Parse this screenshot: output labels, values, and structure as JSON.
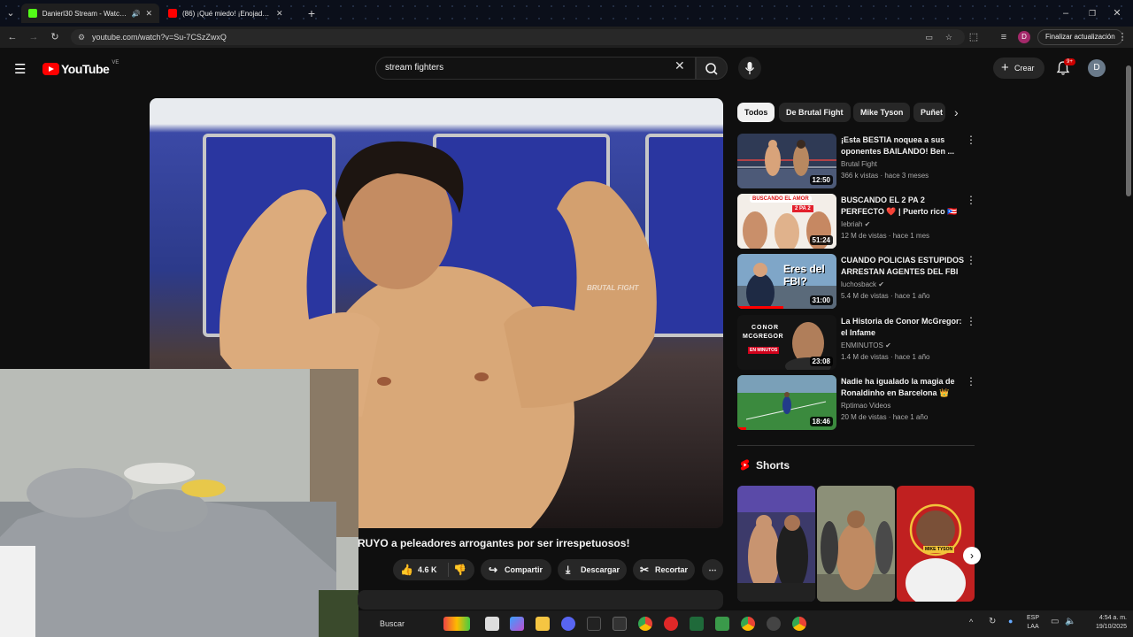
{
  "browser": {
    "tabs": [
      {
        "label": "Danierl30 Stream - Watch L",
        "active": true
      },
      {
        "label": "(86) ¡Qué miedo! ¡Enojado Mik",
        "active": false
      }
    ],
    "url": "youtube.com/watch?v=Su-7CSzZwxQ",
    "update_label": "Finalizar actualización"
  },
  "youtube": {
    "logo_text": "YouTube",
    "country_code": "VE",
    "search_value": "stream fighters",
    "create_label": "Crear",
    "notification_badge": "9+",
    "avatar_letter": "D"
  },
  "video": {
    "title": "RUYO a peleadores arrogantes por ser irrespetuosos!",
    "watermark": "BRUTAL FIGHT",
    "actions": {
      "likes": "4.6 K",
      "share": "Compartir",
      "download": "Descargar",
      "clip": "Recortar"
    }
  },
  "chips": [
    "Todos",
    "De Brutal Fight",
    "Mike Tyson",
    "Puñet"
  ],
  "recommendations": [
    {
      "title": "¡Esta BESTIA noquea a sus oponentes BAILANDO! Ben ...",
      "channel": "Brutal Fight",
      "stats": "366 k vistas · hace 3 meses",
      "duration": "12:50"
    },
    {
      "title": "BUSCANDO EL 2 PA 2 PERFECTO ❤️ | Puerto rico 🇵🇷",
      "channel": "Iebriah ✔",
      "stats": "12 M de vistas · hace 1 mes",
      "duration": "51:24"
    },
    {
      "title": "CUANDO POLICIAS ESTUPIDOS ARRESTAN AGENTES DEL FBI",
      "channel": "luchosback ✔",
      "stats": "5.4 M de vistas · hace 1 año",
      "duration": "31:00"
    },
    {
      "title": "La Historia de Conor McGregor: el Infame",
      "channel": "ENMINUTOS ✔",
      "stats": "1.4 M de vistas · hace 1 año",
      "duration": "23:08"
    },
    {
      "title": "Nadie ha igualado la magia de Ronaldinho en Barcelona 👑",
      "channel": "Rptimao Videos",
      "stats": "20 M de vistas · hace 1 año",
      "duration": "18:46"
    }
  ],
  "thumb_text": {
    "t2_banner": "BUSCANDO EL AMOR",
    "t2_sub": "2 PA 2",
    "t3_text": "Eres del FBI?",
    "t4_line1": "CONOR",
    "t4_line2": "MCGREGOR",
    "t4_line3": "EN MINUTOS",
    "short3_caption": "MIKE TYSON"
  },
  "shorts_title": "Shorts",
  "taskbar": {
    "search_label": "Buscar",
    "lang_1": "ESP",
    "lang_2": "LAA",
    "time": "4:54 a. m.",
    "date": "19/10/2025"
  }
}
